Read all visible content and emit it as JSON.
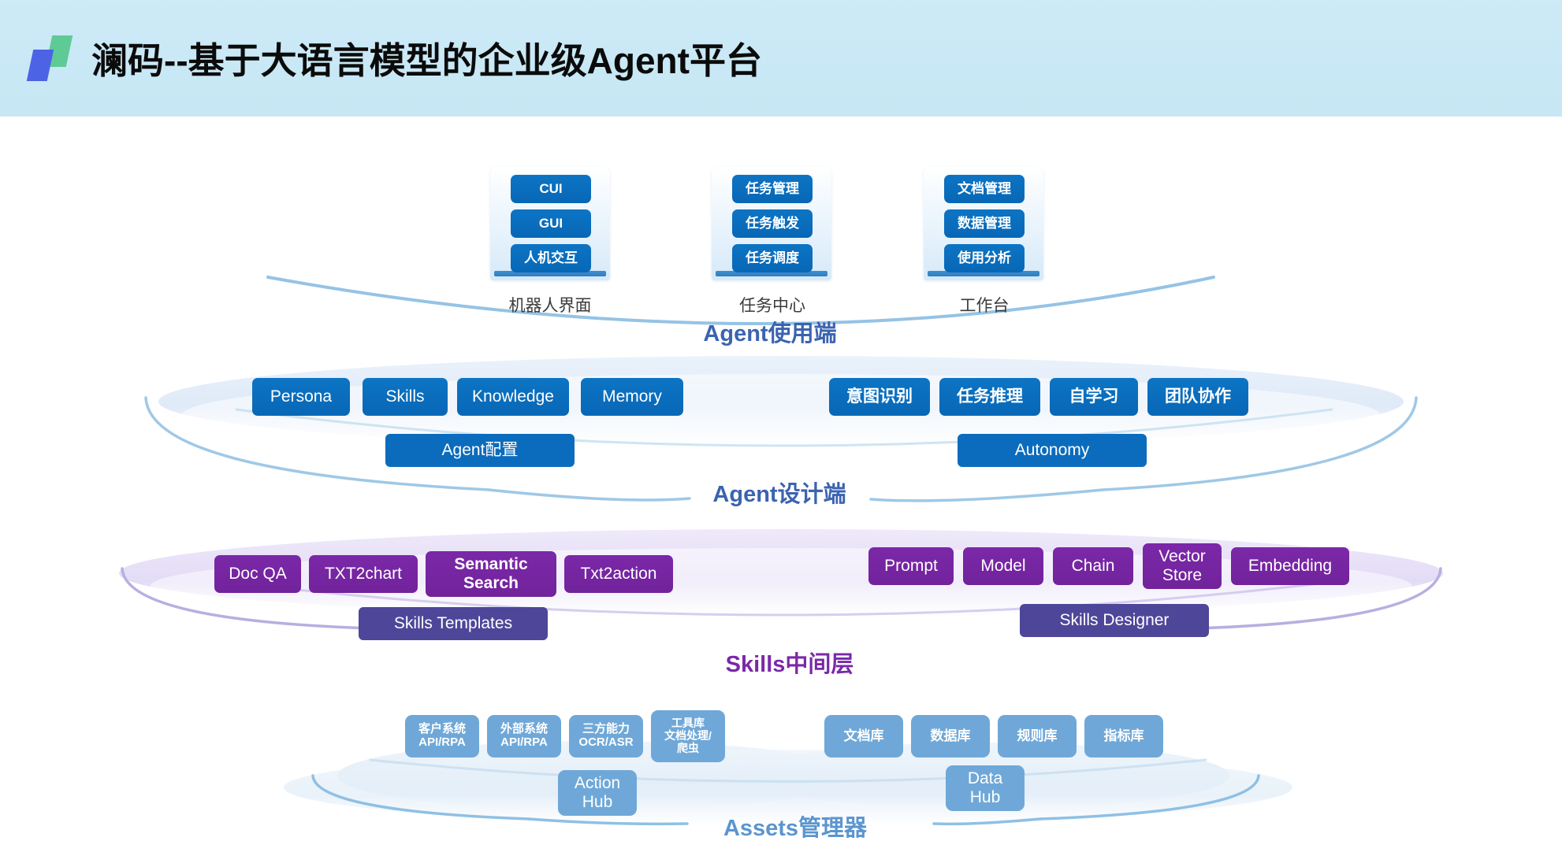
{
  "header": {
    "title": "澜码--基于大语言模型的企业级Agent平台",
    "logo_name": "lanma-logo",
    "bg_color": "#c9e8f5"
  },
  "colors": {
    "blue_box": "#0b6cbd",
    "purple_box": "#7b28a8",
    "light_blue_box": "#6fa8d8",
    "blue_band": "#0b6cbd",
    "purple_band": "#4e4699",
    "heading_blue": "#3b63b0",
    "heading_purple": "#7b28a8",
    "heading_light_blue": "#5b95cf",
    "arc_blue": "#8fc0e4",
    "arc_purple": "#b9aee0",
    "connector_amber": "#f0b429",
    "connector_gray": "#9aa6b2"
  },
  "tiers": [
    {
      "id": "agent-usage",
      "heading": "Agent使用端",
      "heading_color": "#3b63b0",
      "groups": [
        {
          "label": "机器人界面",
          "items": [
            "CUI",
            "GUI",
            "人机交互"
          ]
        },
        {
          "label": "任务中心",
          "items": [
            "任务管理",
            "任务触发",
            "任务调度"
          ]
        },
        {
          "label": "工作台",
          "items": [
            "文档管理",
            "数据管理",
            "使用分析"
          ]
        }
      ]
    },
    {
      "id": "agent-design",
      "heading": "Agent设计端",
      "heading_color": "#3b63b0",
      "left": {
        "band": "Agent配置",
        "items": [
          "Persona",
          "Skills",
          "Knowledge",
          "Memory"
        ]
      },
      "right": {
        "band": "Autonomy",
        "items": [
          "意图识别",
          "任务推理",
          "自学习",
          "团队协作"
        ]
      }
    },
    {
      "id": "skills-middle",
      "heading": "Skills中间层",
      "heading_color": "#7b28a8",
      "left": {
        "band": "Skills Templates",
        "items": [
          "Doc QA",
          "TXT2chart",
          "Semantic\nSearch",
          "Txt2action"
        ]
      },
      "right": {
        "band": "Skills Designer",
        "items": [
          "Prompt",
          "Model",
          "Chain",
          "Vector\nStore",
          "Embedding"
        ]
      }
    },
    {
      "id": "assets-manager",
      "heading": "Assets管理器",
      "heading_color": "#5b95cf",
      "left": {
        "band": "Action\nHub",
        "items": [
          "客户系统\nAPI/RPA",
          "外部系统\nAPI/RPA",
          "三方能力\nOCR/ASR",
          "工具库\n文档处理/\n爬虫"
        ]
      },
      "right": {
        "band": "Data\nHub",
        "items": [
          "文档库",
          "数据库",
          "规则库",
          "指标库"
        ]
      }
    }
  ]
}
